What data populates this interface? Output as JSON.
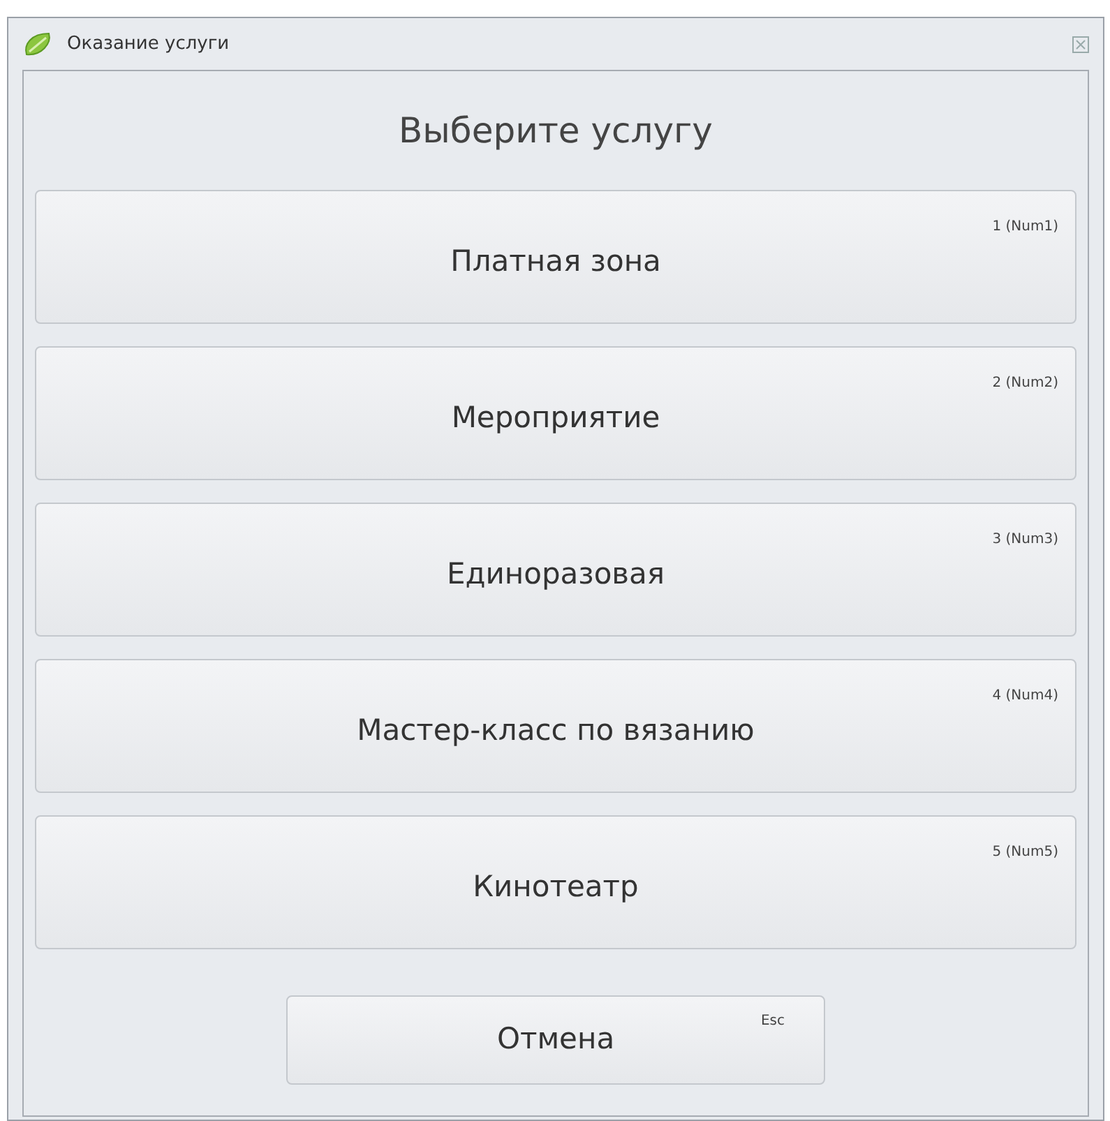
{
  "window": {
    "title": "Оказание услуги"
  },
  "heading": "Выберите услугу",
  "services": [
    {
      "label": "Платная зона",
      "shortcut": "1 (Num1)"
    },
    {
      "label": "Мероприятие",
      "shortcut": "2 (Num2)"
    },
    {
      "label": "Единоразовая",
      "shortcut": "3 (Num3)"
    },
    {
      "label": "Мастер-класс по вязанию",
      "shortcut": "4 (Num4)"
    },
    {
      "label": "Кинотеатр",
      "shortcut": "5 (Num5)"
    }
  ],
  "cancel": {
    "label": "Отмена",
    "shortcut": "Esc"
  }
}
